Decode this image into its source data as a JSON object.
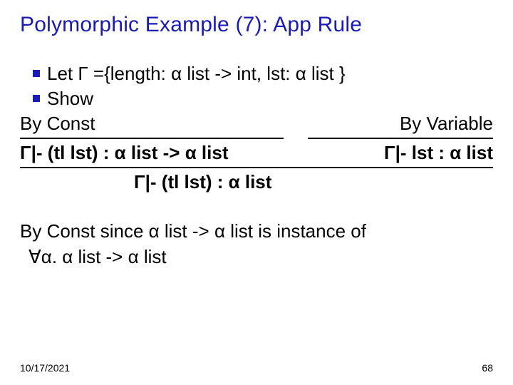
{
  "title": "Polymorphic Example (7): App Rule",
  "bullets": {
    "let": "Let  Γ ={length: α list -> int,  lst: α list }",
    "show": "Show"
  },
  "labels": {
    "by_const": "By Const",
    "by_variable": "By Variable"
  },
  "premises": {
    "left": "Γ|- (tl lst) : α list -> α list",
    "right": "Γ|- lst : α list"
  },
  "conclusion": "Γ|- (tl lst) : α list",
  "explain": {
    "line1": "By Const since α list -> α list is instance of",
    "line2": "∀α. α list -> α list"
  },
  "footer": {
    "date": "10/17/2021",
    "page": "68"
  }
}
